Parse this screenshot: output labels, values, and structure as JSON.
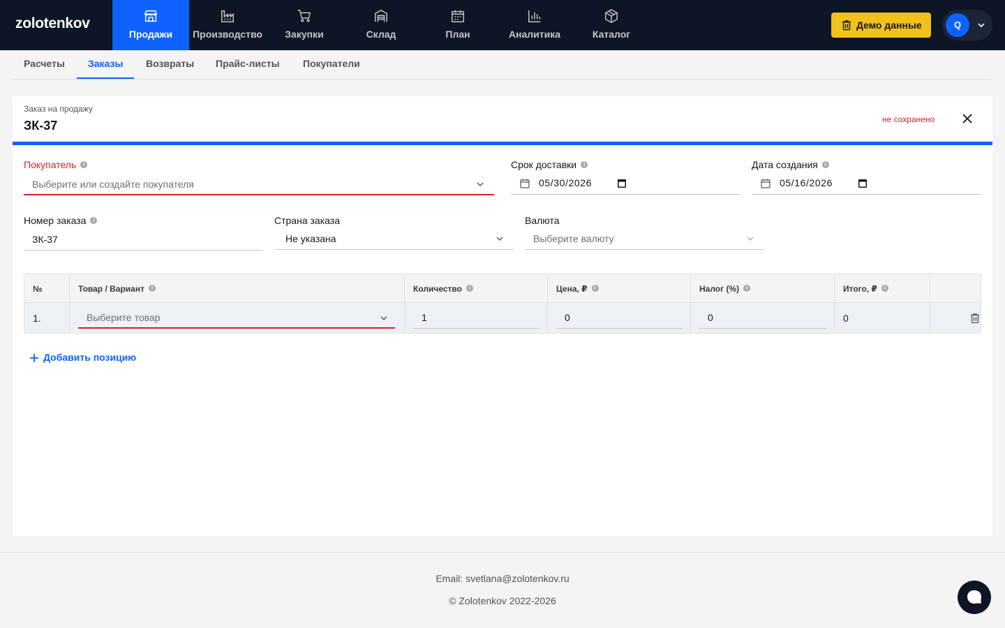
{
  "app": {
    "logo": "zolotenkov"
  },
  "nav": {
    "items": [
      {
        "label": "Продажи",
        "icon": "store-icon",
        "active": true
      },
      {
        "label": "Производство",
        "icon": "factory-icon"
      },
      {
        "label": "Закупки",
        "icon": "cart-icon"
      },
      {
        "label": "Склад",
        "icon": "warehouse-icon"
      },
      {
        "label": "План",
        "icon": "calendar-icon"
      },
      {
        "label": "Аналитика",
        "icon": "bar-chart-icon"
      },
      {
        "label": "Каталог",
        "icon": "cube-icon"
      }
    ],
    "demo_button": "Демо данные",
    "user_initial": "Q"
  },
  "subtabs": [
    {
      "label": "Расчеты"
    },
    {
      "label": "Заказы",
      "active": true
    },
    {
      "label": "Возвраты"
    },
    {
      "label": "Прайс-листы"
    },
    {
      "label": "Покупатели"
    }
  ],
  "order": {
    "kicker": "Заказ на продажу",
    "title": "ЗК-37",
    "status": "не сохранено"
  },
  "form": {
    "buyer": {
      "label": "Покупатель",
      "placeholder": "Выберите или создайте покупателя"
    },
    "delivery": {
      "label": "Срок доставки",
      "value": "05/30/2026"
    },
    "created": {
      "label": "Дата создания",
      "value": "05/16/2026"
    },
    "order_number": {
      "label": "Номер заказа",
      "value": "ЗК-37"
    },
    "country": {
      "label": "Страна заказа",
      "value": "Не указана"
    },
    "currency": {
      "label": "Валюта",
      "placeholder": "Выберите валюту"
    }
  },
  "table": {
    "headers": {
      "num": "№",
      "product": "Товар / Вариант",
      "qty": "Количество",
      "price": "Цена, ₽",
      "tax": "Налог (%)",
      "total": "Итого, ₽"
    },
    "rows": [
      {
        "num": "1.",
        "product_placeholder": "Выберите товар",
        "qty": "1",
        "price": "0",
        "tax": "0",
        "total": "0"
      }
    ],
    "add_row": "Добавить позицию"
  },
  "footer": {
    "email": "Email: svetlana@zolotenkov.ru",
    "copyright": "© Zolotenkov 2022-2026"
  },
  "colors": {
    "nav_bg": "#0d1526",
    "accent": "#0f62fe",
    "error": "#da1e28",
    "demo_button": "#f1c21b"
  }
}
